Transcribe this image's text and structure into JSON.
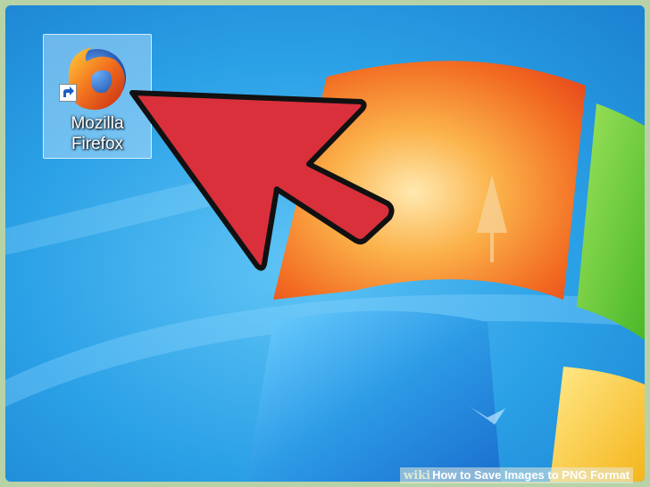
{
  "desktop": {
    "icons": [
      {
        "label": "Mozilla\nFirefox",
        "icon": "firefox-icon",
        "shortcut": true
      }
    ]
  },
  "annotation": {
    "icon": "red-arrow-icon",
    "color": "#d9303c",
    "outline": "#111111"
  },
  "watermark": {
    "brand": "wiki",
    "text": "How to Save Images to PNG Format"
  },
  "colors": {
    "desktop_blue": "#2aa0e6",
    "flag_orange": "#f26a21",
    "flag_green": "#5cc22e",
    "flag_blue": "#1f7fd6",
    "flag_yellow": "#f5c21b"
  }
}
